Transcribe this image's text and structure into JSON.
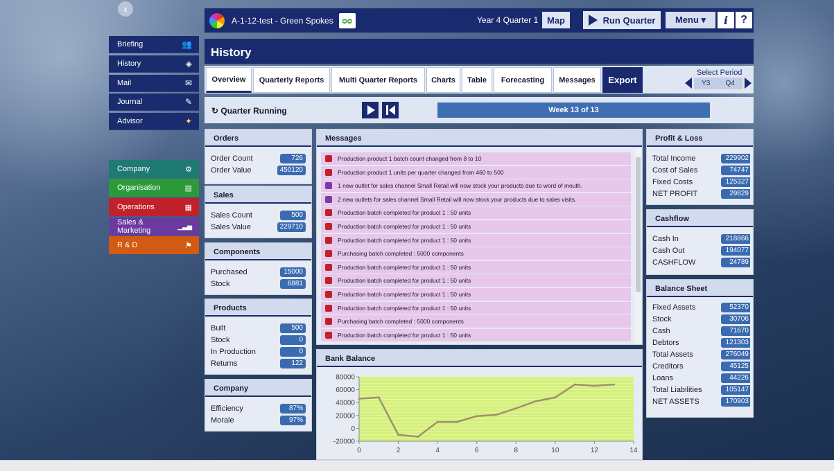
{
  "header": {
    "app_title": "A-1-12-test - Green Spokes",
    "period": "Year 4 Quarter 1",
    "map_label": "Map",
    "run_quarter_label": "Run Quarter",
    "menu_label": "Menu ▾",
    "info_label": "i",
    "help_label": "?"
  },
  "sidebar": {
    "items": [
      {
        "label": "Briefing",
        "icon": "people-icon",
        "glyph": "👥"
      },
      {
        "label": "History",
        "icon": "diamond-icon",
        "glyph": "◈"
      },
      {
        "label": "Mail",
        "icon": "envelope-icon",
        "glyph": "✉"
      },
      {
        "label": "Journal",
        "icon": "pen-icon",
        "glyph": "✎"
      },
      {
        "label": "Advisor",
        "icon": "lightbulb-icon",
        "glyph": "✦"
      }
    ],
    "departments": [
      {
        "label": "Company",
        "color": "#1f7a73",
        "icon": "gears-icon",
        "glyph": "⚙"
      },
      {
        "label": "Organisation",
        "color": "#2d9a3a",
        "icon": "clipboard-icon",
        "glyph": "▤"
      },
      {
        "label": "Operations",
        "color": "#c0212a",
        "icon": "factory-icon",
        "glyph": "▦"
      },
      {
        "label": "Sales & Marketing",
        "color": "#6a3a9e",
        "icon": "bar-chart-icon",
        "glyph": "▁▃▅"
      },
      {
        "label": "R & D",
        "color": "#d25a12",
        "icon": "flask-icon",
        "glyph": "⚑"
      }
    ]
  },
  "page": {
    "title": "History",
    "tabs": [
      "Overview",
      "Quarterly Reports",
      "Multi Quarter Reports",
      "Charts",
      "Table",
      "Forecasting",
      "Messages",
      "Export"
    ],
    "select_period_label": "Select Period",
    "period_year": "Y3",
    "period_quarter": "Q4",
    "quarter_running_label": "Quarter Running",
    "week_label": "Week 13 of 13"
  },
  "orders": {
    "title": "Orders",
    "rows": [
      {
        "label": "Order Count",
        "value": "726"
      },
      {
        "label": "Order Value",
        "value": "450120"
      }
    ]
  },
  "sales": {
    "title": "Sales",
    "rows": [
      {
        "label": "Sales Count",
        "value": "500"
      },
      {
        "label": "Sales Value",
        "value": "229710"
      }
    ]
  },
  "components": {
    "title": "Components",
    "rows": [
      {
        "label": "Purchased",
        "value": "15000"
      },
      {
        "label": "Stock",
        "value": "6881"
      }
    ]
  },
  "products": {
    "title": "Products",
    "rows": [
      {
        "label": "Built",
        "value": "500"
      },
      {
        "label": "Stock",
        "value": "0"
      },
      {
        "label": "In Production",
        "value": "0"
      },
      {
        "label": "Returns",
        "value": "122"
      }
    ]
  },
  "company": {
    "title": "Company",
    "rows": [
      {
        "label": "Efficiency",
        "value": "87%"
      },
      {
        "label": "Morale",
        "value": "97%"
      }
    ]
  },
  "messages": {
    "title": "Messages",
    "items": [
      {
        "text": "Production product 1 batch count changed from 8 to 10",
        "color": "#c0212a"
      },
      {
        "text": "Production product 1 units per quarter changed from 460 to 500",
        "color": "#c0212a"
      },
      {
        "text": "1 new outlet for sales channel Small Retail will now stock your products due to word of mouth.",
        "color": "#7a3aa8"
      },
      {
        "text": "2 new outlets for sales channel Small Retail will now stock your products due to sales visits.",
        "color": "#7a3aa8"
      },
      {
        "text": "Production batch completed for product 1 : 50 units",
        "color": "#c0212a"
      },
      {
        "text": "Production batch completed for product 1 : 50 units",
        "color": "#c0212a"
      },
      {
        "text": "Production batch completed for product 1 : 50 units",
        "color": "#c0212a"
      },
      {
        "text": "Purchasing batch completed : 5000 components",
        "color": "#c0212a"
      },
      {
        "text": "Production batch completed for product 1 : 50 units",
        "color": "#c0212a"
      },
      {
        "text": "Production batch completed for product 1 : 50 units",
        "color": "#c0212a"
      },
      {
        "text": "Production batch completed for product 1 : 50 units",
        "color": "#c0212a"
      },
      {
        "text": "Production batch completed for product 1 : 50 units",
        "color": "#c0212a"
      },
      {
        "text": "Purchasing batch completed : 5000 components",
        "color": "#c0212a"
      },
      {
        "text": "Production batch completed for product 1 : 50 units",
        "color": "#c0212a"
      }
    ]
  },
  "bank": {
    "title": "Bank Balance"
  },
  "chart_data": {
    "type": "line",
    "x": [
      0,
      1,
      2,
      3,
      4,
      5,
      6,
      7,
      8,
      9,
      10,
      11,
      12,
      13
    ],
    "values": [
      46000,
      48000,
      -10000,
      -13000,
      10000,
      10000,
      19000,
      21000,
      31000,
      42000,
      48000,
      68000,
      66000,
      68000
    ],
    "xlim": [
      0,
      14
    ],
    "ylim": [
      -20000,
      80000
    ],
    "xticks": [
      0,
      2,
      4,
      6,
      8,
      10,
      12,
      14
    ],
    "yticks": [
      -20000,
      0,
      20000,
      40000,
      60000,
      80000
    ],
    "grid": true,
    "line_color": "#a09070",
    "background_color": "#d4f07a"
  },
  "profit_loss": {
    "title": "Profit & Loss",
    "rows": [
      {
        "label": "Total Income",
        "value": "229902"
      },
      {
        "label": "Cost of Sales",
        "value": "74747"
      },
      {
        "label": "Fixed Costs",
        "value": "125327"
      },
      {
        "label": "NET PROFIT",
        "value": "29829"
      }
    ]
  },
  "cashflow": {
    "title": "Cashflow",
    "rows": [
      {
        "label": "Cash In",
        "value": "218866"
      },
      {
        "label": "Cash Out",
        "value": "194077"
      },
      {
        "label": "CASHFLOW",
        "value": "24789"
      }
    ]
  },
  "balance_sheet": {
    "title": "Balance Sheet",
    "rows": [
      {
        "label": "Fixed Assets",
        "value": "52370"
      },
      {
        "label": "Stock",
        "value": "30706"
      },
      {
        "label": "Cash",
        "value": "71670"
      },
      {
        "label": "Debtors",
        "value": "121303"
      },
      {
        "label": "Total Assets",
        "value": "276049"
      },
      {
        "label": "Creditors",
        "value": "45125"
      },
      {
        "label": "Loans",
        "value": "44226"
      },
      {
        "label": "Total Liabilities",
        "value": "105147"
      },
      {
        "label": "NET ASSETS",
        "value": "170903"
      }
    ]
  }
}
